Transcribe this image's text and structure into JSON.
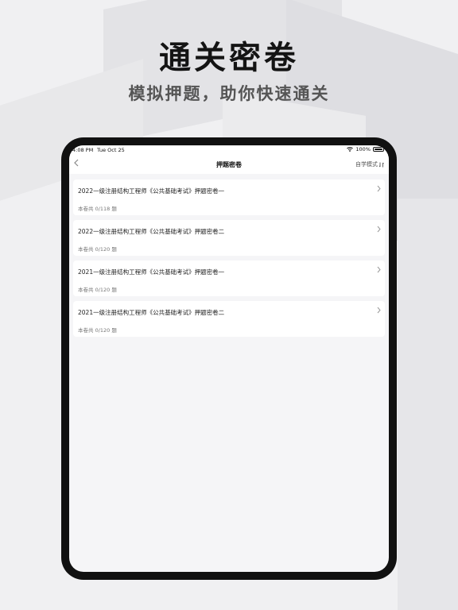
{
  "hero": {
    "title": "通关密卷",
    "subtitle": "模拟押题，助你快速通关"
  },
  "statusbar": {
    "time": "4:08 PM",
    "date": "Tue Oct 25",
    "battery": "100%"
  },
  "navbar": {
    "back_icon": "chevron-left-icon",
    "title": "押题密卷",
    "mode_label": "自学模式",
    "mode_icon": "switch-icon"
  },
  "papers": [
    {
      "title": "2022一级注册结构工程师《公共基础考试》押题密卷一",
      "meta": "本卷共 0/118 题"
    },
    {
      "title": "2022一级注册结构工程师《公共基础考试》押题密卷二",
      "meta": "本卷共 0/120 题"
    },
    {
      "title": "2021一级注册结构工程师《公共基础考试》押题密卷一",
      "meta": "本卷共 0/120 题"
    },
    {
      "title": "2021一级注册结构工程师《公共基础考试》押题密卷二",
      "meta": "本卷共 0/120 题"
    }
  ],
  "colors": {
    "device_frame": "#111111",
    "screen_bg": "#f5f5f7",
    "card_bg": "#ffffff"
  }
}
